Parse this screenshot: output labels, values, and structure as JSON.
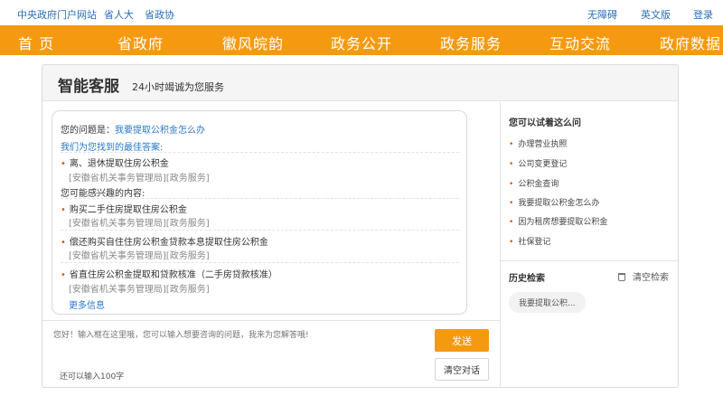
{
  "topbar": {
    "links": [
      "中央政府门户网站",
      "省人大",
      "省政协"
    ],
    "right_links": [
      "无障碍",
      "英文版",
      "登录"
    ]
  },
  "nav": {
    "items": [
      "首 页",
      "省政府",
      "徽风皖韵",
      "政务公开",
      "政务服务",
      "互动交流",
      "政府数据"
    ],
    "color": "#f59a10"
  },
  "panel": {
    "title": "智能客服",
    "subtitle": "24小时竭诚为您服务"
  },
  "chat": {
    "question_label": "您的问题是：",
    "question": "我要提取公积金怎么办",
    "best_answer_label": "我们为您找到的最佳答案:",
    "best_results": [
      {
        "title": "离、退休提取住房公积金",
        "source": "[安徽省机关事务管理局][政务服务]"
      }
    ],
    "maybe_label": "您可能感兴趣的内容:",
    "maybe_results": [
      {
        "title": "购买二手住房提取住房公积金",
        "source": "[安徽省机关事务管理局][政务服务]"
      },
      {
        "title": "偿还购买自住住房公积金贷款本息提取住房公积金",
        "source": "[安徽省机关事务管理局][政务服务]"
      },
      {
        "title": "省直住房公积金提取和贷款核准（二手房贷款核准）",
        "source": "[安徽省机关事务管理局][政务服务]"
      }
    ],
    "more": "更多信息"
  },
  "input": {
    "placeholder": "您好！输入框在这里哦，您可以输入想要咨询的问题，我来为您解答哦!",
    "counter": "还可以输入100字",
    "send_label": "发送",
    "clear_label": "清空对话"
  },
  "sidebar": {
    "suggest_title": "您可以试着这么问",
    "suggestions": [
      "办理营业执照",
      "公司变更登记",
      "公积金查询",
      "我要提取公积金怎么办",
      "因为租房想要提取公积金",
      "社保登记"
    ],
    "history_title": "历史检索",
    "clear_history": "清空检索",
    "history_items": [
      "我要提取公积..."
    ]
  }
}
